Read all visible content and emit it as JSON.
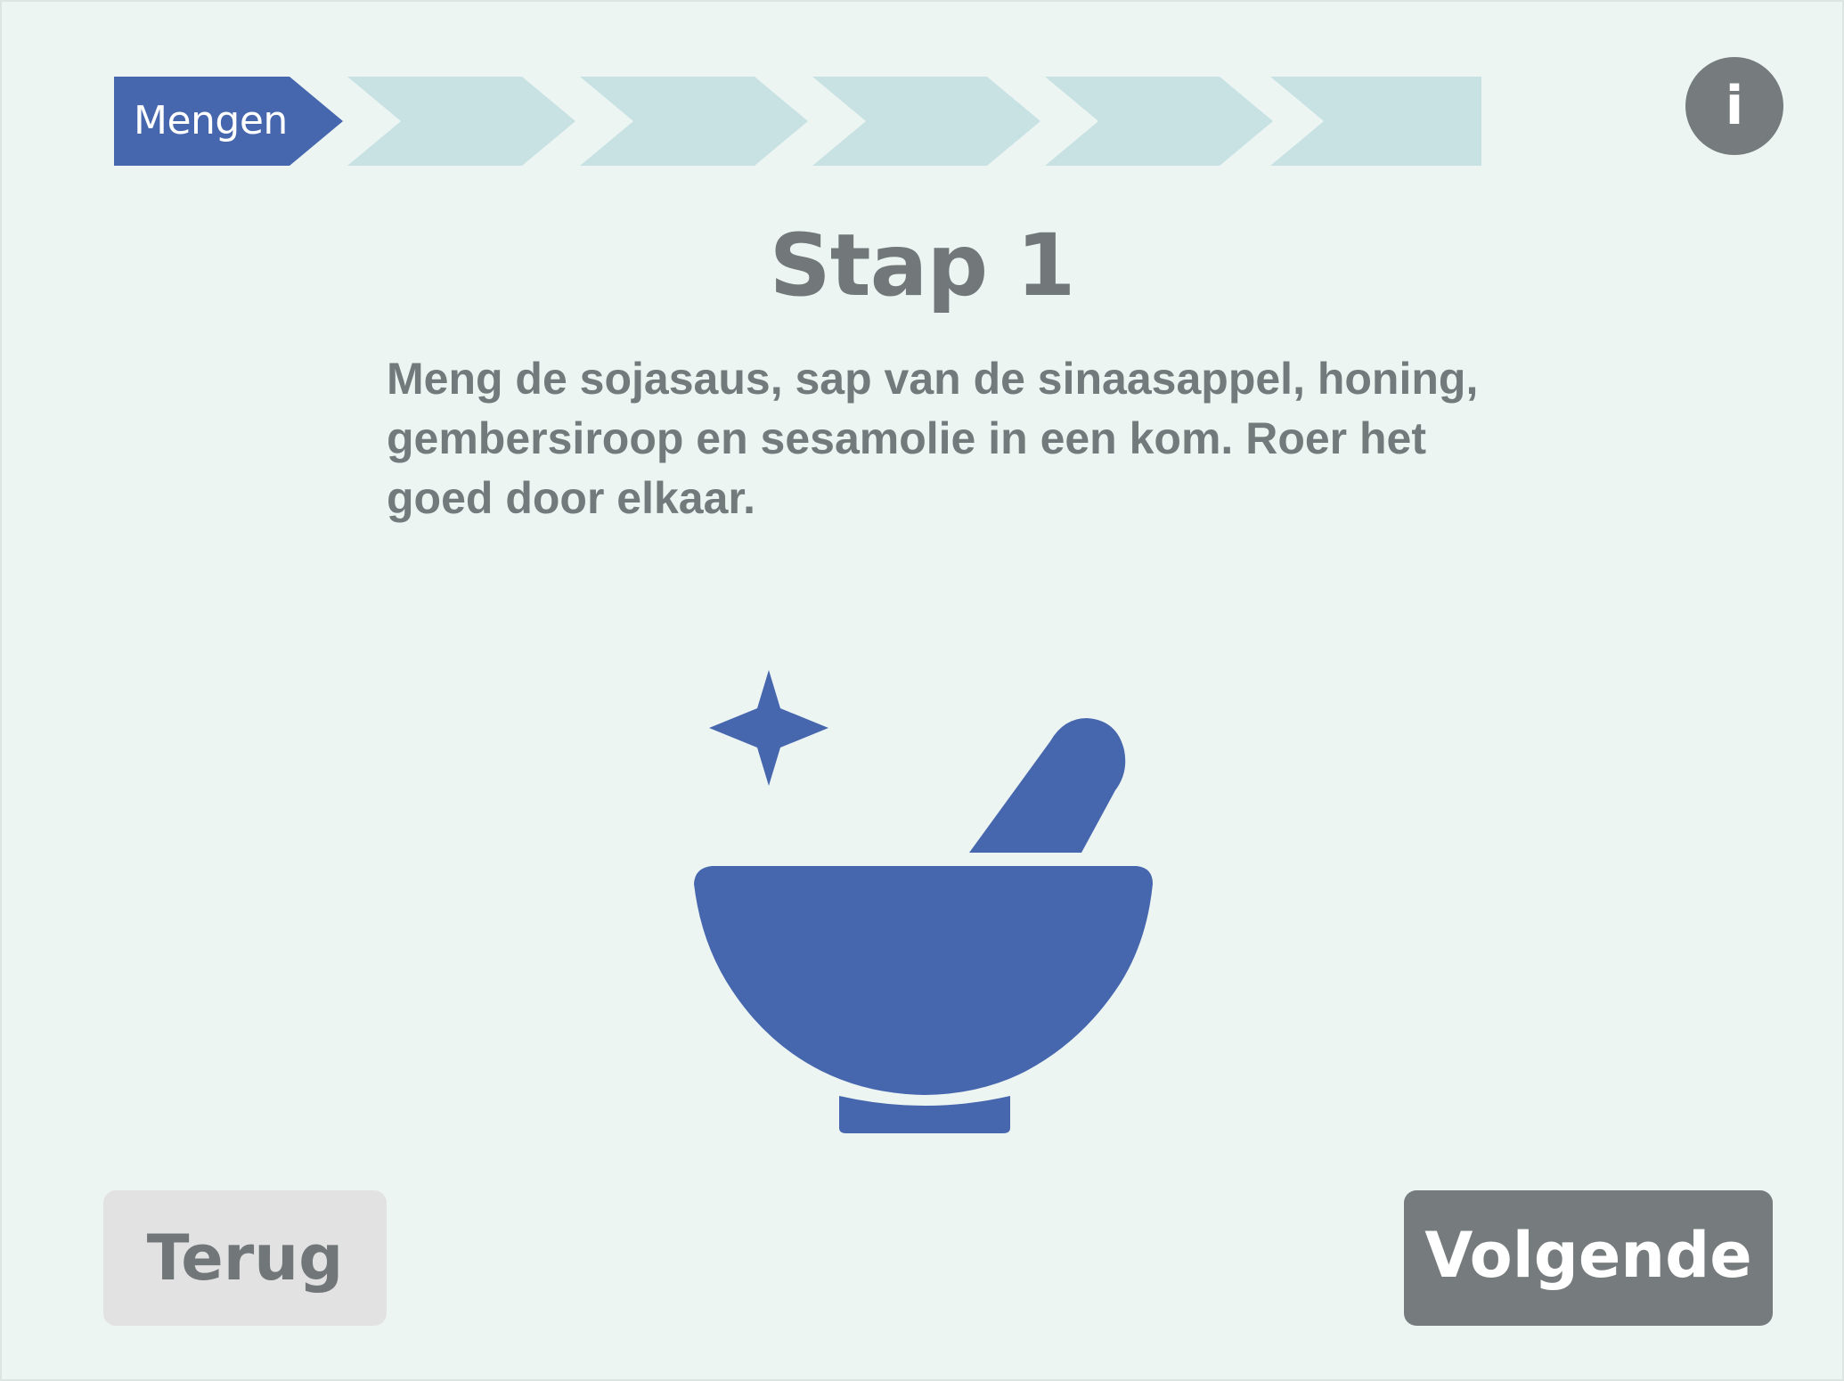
{
  "progress": {
    "current_step_label": "Mengen",
    "total_steps": 6,
    "current_step": 1,
    "active_color": "#4666ae",
    "inactive_color": "#c8e2e4"
  },
  "info_button": {
    "label": "i",
    "icon": "info-icon"
  },
  "step": {
    "title": "Stap 1",
    "instruction": "Meng de sojasaus, sap van de sinaasappel, honing, gembersiroop en sesamolie in een kom. Roer het goed door elkaar."
  },
  "illustration": {
    "icon": "mortar-and-pestle-icon",
    "accent_icon": "sparkle-icon",
    "color": "#4666ae"
  },
  "navigation": {
    "back_label": "Terug",
    "next_label": "Volgende"
  }
}
